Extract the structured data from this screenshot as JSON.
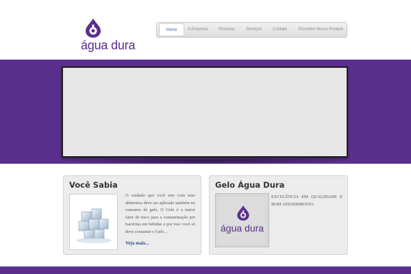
{
  "brand": {
    "name": "água dura",
    "color": "#5b2f8d"
  },
  "nav": {
    "items": [
      {
        "label": "Home",
        "active": true
      },
      {
        "label": "A Empresa"
      },
      {
        "label": "Produtos"
      },
      {
        "label": "Serviços"
      },
      {
        "label": "Contato"
      },
      {
        "label": "Encontre Nosso Produto"
      }
    ]
  },
  "boxes": {
    "left": {
      "title": "Você Sabia",
      "text": "O cuidado que você tem com seus alimentos deve ser aplicado também no consumo de gelo. O Gelo é o maior fator de risco para a contaminação por bactérias em bebidas e por isso você só deve consumir o Gelo...",
      "more": "Veja mais..."
    },
    "right": {
      "title": "Gelo Água Dura",
      "text": "EXCELÊNCIA EM QUALIDADE E BOM ATENDIMENTO.",
      "logo_text": "água dura"
    }
  }
}
